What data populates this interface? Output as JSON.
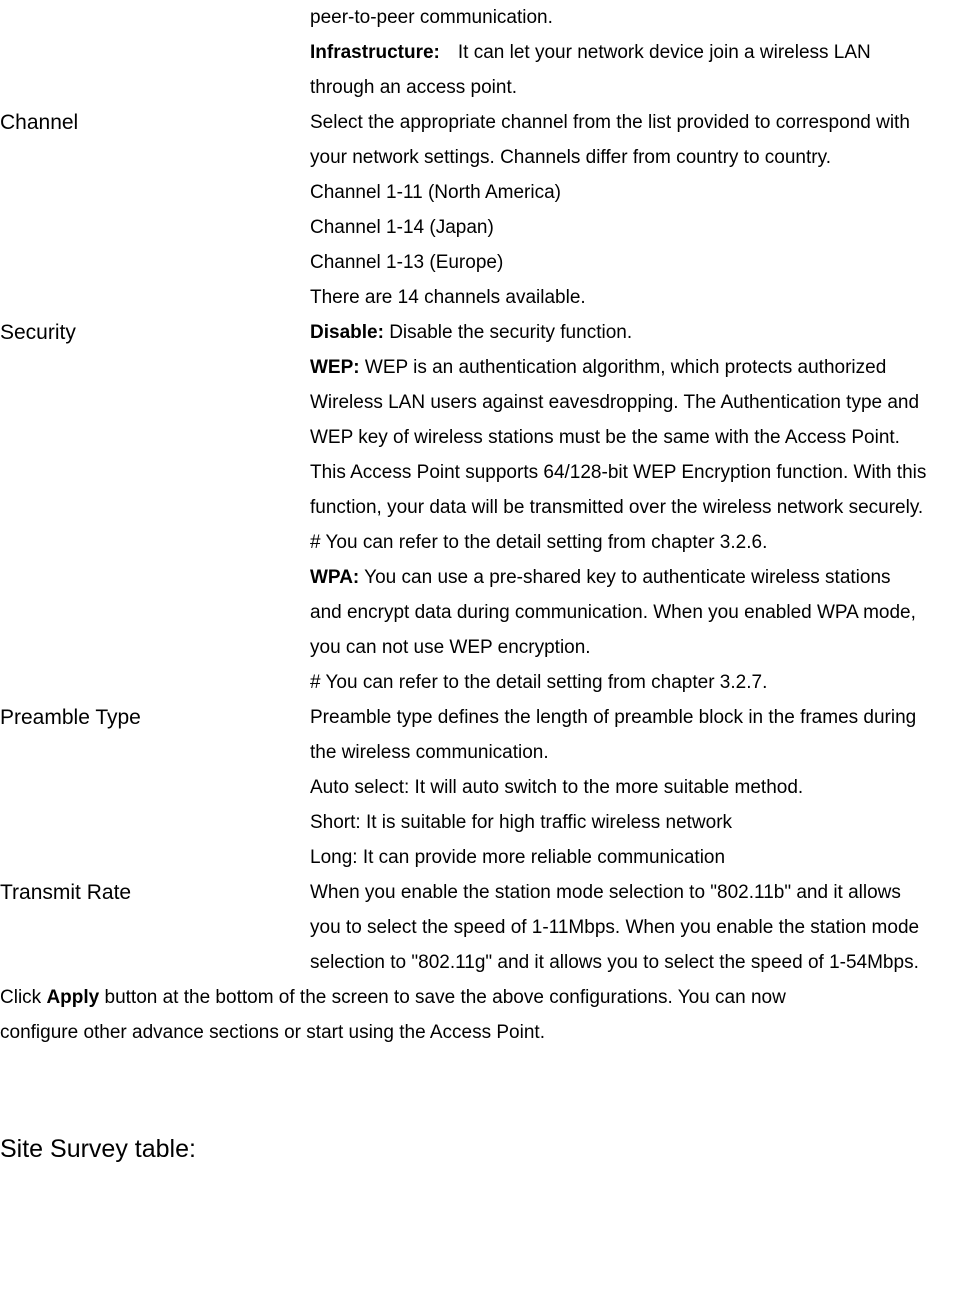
{
  "rows": [
    {
      "label": "",
      "lines": [
        {
          "bold": null,
          "text": "peer-to-peer communication."
        },
        {
          "bold": "Infrastructure:",
          "text": "It can let your network device join a wireless LAN",
          "wideGap": true
        },
        {
          "bold": null,
          "text": "through an access point."
        }
      ]
    },
    {
      "label": "Channel",
      "lines": [
        {
          "bold": null,
          "text": "Select the appropriate channel from the list provided to correspond with"
        },
        {
          "bold": null,
          "text": "your network settings. Channels differ from country to country."
        },
        {
          "bold": null,
          "text": "Channel 1-11 (North America)"
        },
        {
          "bold": null,
          "text": "Channel 1-14 (Japan)"
        },
        {
          "bold": null,
          "text": "Channel 1-13 (Europe)"
        },
        {
          "bold": null,
          "text": "There are 14 channels available."
        }
      ]
    },
    {
      "label": "Security",
      "lines": [
        {
          "bold": "Disable:",
          "text": " Disable the security function."
        },
        {
          "bold": "WEP:",
          "text": " WEP is an authentication algorithm, which protects authorized"
        },
        {
          "bold": null,
          "text": "Wireless LAN users against eavesdropping. The Authentication type and"
        },
        {
          "bold": null,
          "text": "WEP key of wireless stations must be the same with the Access Point."
        },
        {
          "bold": null,
          "text": "This Access Point supports 64/128-bit WEP Encryption function. With this"
        },
        {
          "bold": null,
          "text": "function, your data will be transmitted over the wireless network securely."
        },
        {
          "bold": null,
          "text": "# You can refer to the detail setting from chapter 3.2.6."
        },
        {
          "bold": "WPA:",
          "text": " You can use a pre-shared key to authenticate wireless stations"
        },
        {
          "bold": null,
          "text": "and encrypt data during communication. When you enabled WPA mode,"
        },
        {
          "bold": null,
          "text": "you can not use WEP encryption."
        },
        {
          "bold": null,
          "text": "# You can refer to the detail setting from chapter 3.2.7."
        }
      ]
    },
    {
      "label": "Preamble Type",
      "lines": [
        {
          "bold": null,
          "text": "Preamble type defines the length of preamble block in the frames during"
        },
        {
          "bold": null,
          "text": "the wireless communication."
        },
        {
          "bold": null,
          "text": "Auto select: It will auto switch to the more suitable method."
        },
        {
          "bold": null,
          "text": "Short: It is suitable for high traffic wireless network"
        },
        {
          "bold": null,
          "text": "Long: It can provide more reliable communication"
        }
      ]
    },
    {
      "label": "Transmit Rate",
      "lines": [
        {
          "bold": null,
          "text": "When you enable the station mode selection to \"802.11b\" and it allows"
        },
        {
          "bold": null,
          "text": "you to select the speed of 1-11Mbps. When you enable the station mode"
        },
        {
          "bold": null,
          "text": "selection to \"802.11g\" and it allows you to select the speed of 1-54Mbps."
        }
      ]
    }
  ],
  "footer": {
    "pre": "Click ",
    "boldWord": "Apply",
    "post1": " button at the bottom of the screen to save the above configurations. You can now",
    "line2": "configure other advance sections or start using the Access Point."
  },
  "sectionHeader": "Site Survey table:"
}
